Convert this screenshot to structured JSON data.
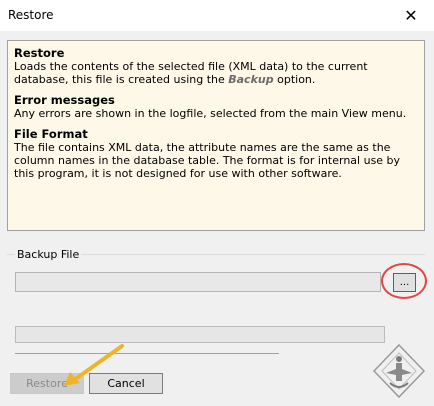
{
  "window": {
    "title": "Restore",
    "close_label": "✕"
  },
  "info": {
    "sections": [
      {
        "heading": "Restore",
        "text_before": "Loads the contents of the selected file (XML data) to the current database, this file is created using the ",
        "emphasis": "Backup",
        "text_after": " option."
      },
      {
        "heading": "Error messages",
        "text": "Any errors are shown in the logfile, selected from the main View menu."
      },
      {
        "heading": "File Format",
        "text": "The file contains XML data, the attribute names are the same as the column names in the database table. The format is for internal use by this program, it is not designed for use with other software."
      }
    ]
  },
  "backup": {
    "label": "Backup File",
    "value": "",
    "browse_label": "..."
  },
  "progress": {
    "value": 0
  },
  "buttons": {
    "restore": "Restore",
    "cancel": "Cancel"
  },
  "colors": {
    "annotation_circle": "#e04848",
    "annotation_arrow": "#f0b429",
    "panel_bg": "#fdf8e8"
  },
  "icons": {
    "close": "close-icon",
    "watermark": "logo-watermark"
  }
}
